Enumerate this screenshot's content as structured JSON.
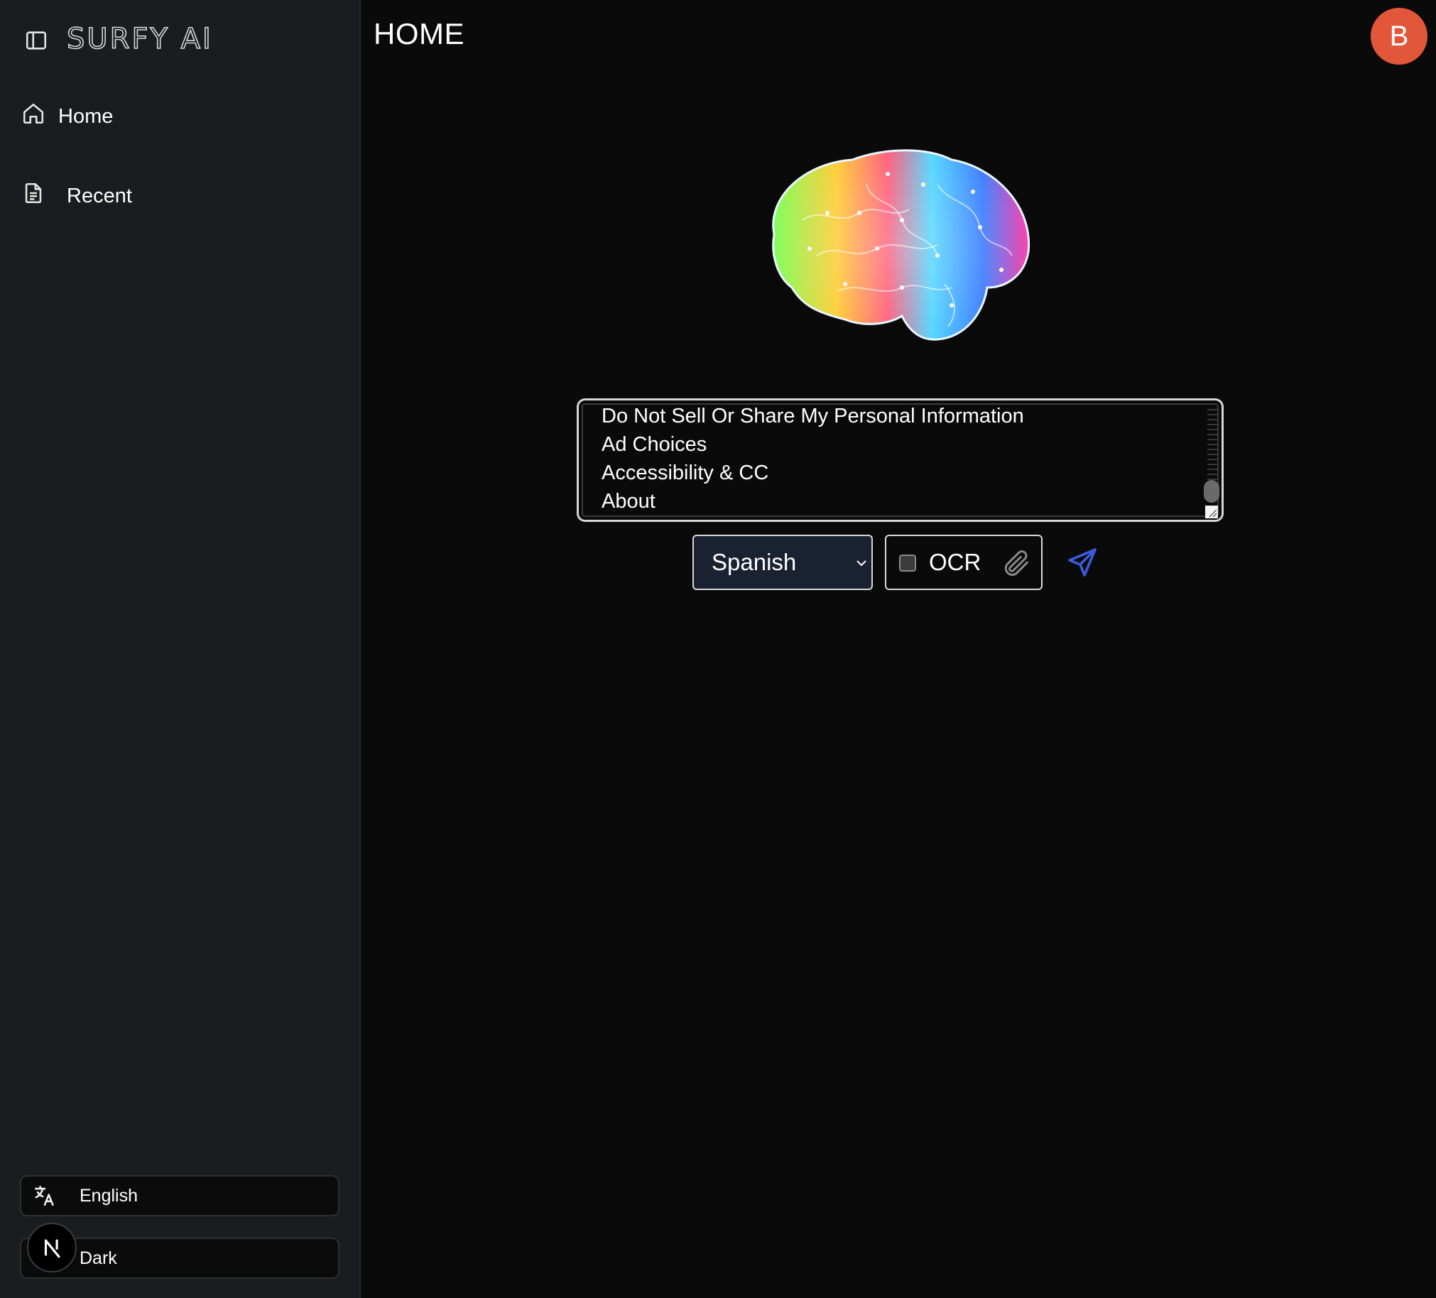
{
  "sidebar": {
    "brand": "SURFY AI",
    "items": [
      {
        "label": "Home",
        "icon": "home-icon"
      },
      {
        "label": "Recent",
        "icon": "document-icon"
      }
    ],
    "language_button": {
      "label": "English",
      "icon": "translate-icon"
    },
    "theme_button": {
      "label": "Dark",
      "badge": "N"
    }
  },
  "header": {
    "title": "HOME",
    "avatar_initial": "B"
  },
  "main": {
    "image": "brain-illustration",
    "input_lines": [
      "Do Not Sell Or Share My Personal Information",
      "Ad Choices",
      "Accessibility & CC",
      "About"
    ],
    "language_select": {
      "selected": "Spanish"
    },
    "ocr": {
      "label": "OCR",
      "checked": false
    },
    "send_icon": "send-icon",
    "attach_icon": "paperclip-icon"
  },
  "colors": {
    "avatar": "#e2573a",
    "send": "#3b5bdb",
    "sidebar_bg": "#1b1c1f",
    "main_bg": "#0a0a0a"
  }
}
